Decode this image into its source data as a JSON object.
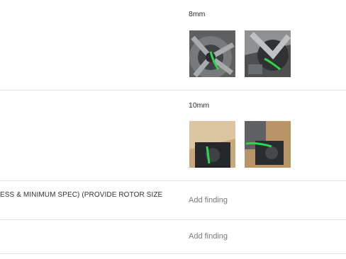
{
  "rows": [
    {
      "value": "8mm",
      "photos": [
        "photo",
        "photo"
      ]
    },
    {
      "value": "10mm",
      "photos": [
        "photo",
        "photo"
      ]
    },
    {
      "label": "ESS & MINIMUM SPEC) (PROVIDE ROTOR SIZE",
      "finding_placeholder": "Add finding"
    },
    {
      "finding_placeholder": "Add finding"
    }
  ],
  "colors": {
    "divider": "#e3e3e3",
    "tag_green": "#2fd64a"
  }
}
